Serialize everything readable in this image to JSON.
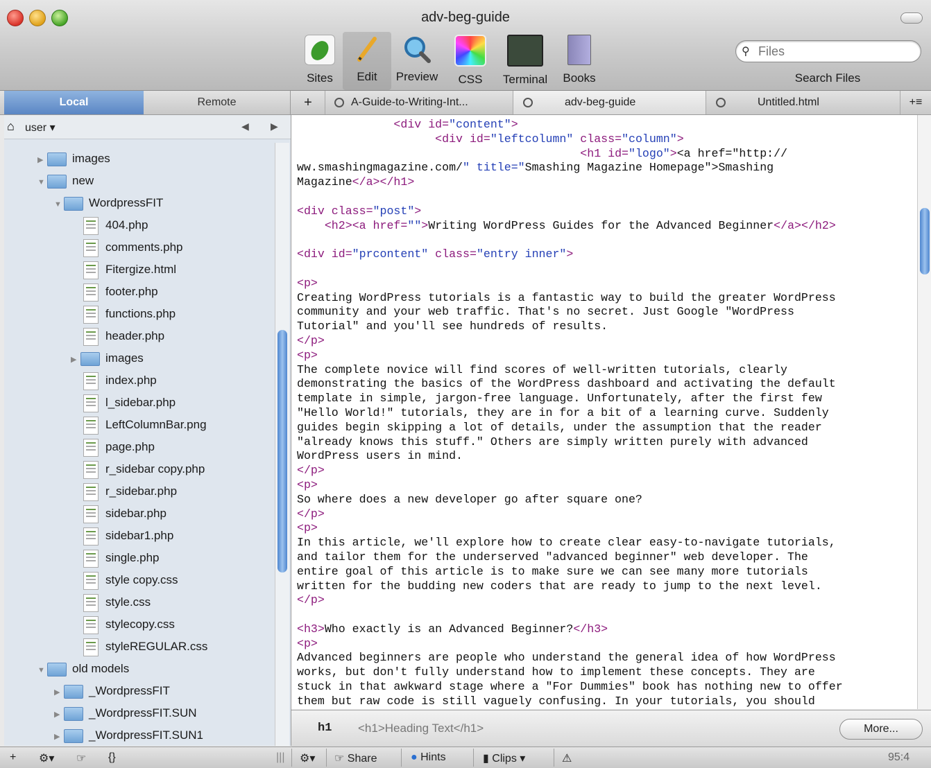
{
  "window": {
    "title": "adv-beg-guide"
  },
  "toolbar": {
    "items": [
      {
        "label": "Sites",
        "icon": "leaf-icon"
      },
      {
        "label": "Edit",
        "icon": "pencil-icon"
      },
      {
        "label": "Preview",
        "icon": "magnifier-icon"
      },
      {
        "label": "CSS",
        "icon": "color-wheel-icon"
      },
      {
        "label": "Terminal",
        "icon": "terminal-icon"
      },
      {
        "label": "Books",
        "icon": "book-icon"
      }
    ],
    "search_placeholder": "Files",
    "search_label": "Search Files"
  },
  "sidebar_tabs": {
    "local": "Local",
    "remote": "Remote"
  },
  "tabs": [
    {
      "label": "A-Guide-to-Writing-Int..."
    },
    {
      "label": "adv-beg-guide"
    },
    {
      "label": "Untitled.html"
    }
  ],
  "pathbar": {
    "user": "user"
  },
  "tree": [
    {
      "label": "images",
      "type": "folder",
      "level": 1,
      "open": false
    },
    {
      "label": "new",
      "type": "folder",
      "level": 1,
      "open": true
    },
    {
      "label": "WordpressFIT",
      "type": "folder",
      "level": 2,
      "open": true
    },
    {
      "label": "404.php",
      "type": "file",
      "level": 3
    },
    {
      "label": "comments.php",
      "type": "file",
      "level": 3
    },
    {
      "label": "Fitergize.html",
      "type": "file",
      "level": 3
    },
    {
      "label": "footer.php",
      "type": "file",
      "level": 3
    },
    {
      "label": "functions.php",
      "type": "file",
      "level": 3
    },
    {
      "label": "header.php",
      "type": "file",
      "level": 3
    },
    {
      "label": "images",
      "type": "folder",
      "level": 3,
      "open": false
    },
    {
      "label": "index.php",
      "type": "file",
      "level": 3
    },
    {
      "label": "l_sidebar.php",
      "type": "file",
      "level": 3
    },
    {
      "label": "LeftColumnBar.png",
      "type": "file",
      "level": 3
    },
    {
      "label": "page.php",
      "type": "file",
      "level": 3
    },
    {
      "label": "r_sidebar copy.php",
      "type": "file",
      "level": 3
    },
    {
      "label": "r_sidebar.php",
      "type": "file",
      "level": 3
    },
    {
      "label": "sidebar.php",
      "type": "file",
      "level": 3
    },
    {
      "label": "sidebar1.php",
      "type": "file",
      "level": 3
    },
    {
      "label": "single.php",
      "type": "file",
      "level": 3
    },
    {
      "label": "style copy.css",
      "type": "file",
      "level": 3
    },
    {
      "label": "style.css",
      "type": "file",
      "level": 3
    },
    {
      "label": "stylecopy.css",
      "type": "file",
      "level": 3
    },
    {
      "label": "styleREGULAR.css",
      "type": "file",
      "level": 3
    },
    {
      "label": "old models",
      "type": "folder",
      "level": 1,
      "open": true
    },
    {
      "label": "_WordpressFIT",
      "type": "folder",
      "level": 2,
      "open": false
    },
    {
      "label": "_WordpressFIT.SUN",
      "type": "folder",
      "level": 2,
      "open": false
    },
    {
      "label": "_WordpressFIT.SUN1",
      "type": "folder",
      "level": 2,
      "open": false
    }
  ],
  "code_lines": [
    "              <div id=\"content\">",
    "                    <div id=\"leftcolumn\" class=\"column\">",
    "                                         <h1 id=\"logo\"><a href=\"http://",
    "ww.smashingmagazine.com/\" title=\"Smashing Magazine Homepage\">Smashing",
    "Magazine</a></h1>",
    "",
    "<div class=\"post\">",
    "    <h2><a href=\"\">Writing WordPress Guides for the Advanced Beginner</a></h2>",
    "",
    "<div id=\"prcontent\" class=\"entry inner\">",
    "",
    "<p>",
    "Creating WordPress tutorials is a fantastic way to build the greater WordPress",
    "community and your web traffic. That's no secret. Just Google \"WordPress",
    "Tutorial\" and you'll see hundreds of results.",
    "</p>",
    "<p>",
    "The complete novice will find scores of well-written tutorials, clearly",
    "demonstrating the basics of the WordPress dashboard and activating the default",
    "template in simple, jargon-free language. Unfortunately, after the first few",
    "\"Hello World!\" tutorials, they are in for a bit of a learning curve. Suddenly",
    "guides begin skipping a lot of details, under the assumption that the reader",
    "\"already knows this stuff.\" Others are simply written purely with advanced",
    "WordPress users in mind.",
    "</p>",
    "<p>",
    "So where does a new developer go after square one?",
    "</p>",
    "<p>",
    "In this article, we'll explore how to create clear easy-to-navigate tutorials,",
    "and tailor them for the underserved \"advanced beginner\" web developer. The",
    "entire goal of this article is to make sure we can see many more tutorials",
    "written for the budding new coders that are ready to jump to the next level.",
    "</p>",
    "",
    "<h3>Who exactly is an Advanced Beginner?</h3>",
    "<p>",
    "Advanced beginners are people who understand the general idea of how WordPress",
    "works, but don't fully understand how to implement these concepts. They are",
    "stuck in that awkward stage where a \"For Dummies\" book has nothing new to offer",
    "them but raw code is still vaguely confusing. In your tutorials, you should"
  ],
  "tagbar": {
    "tag": "h1",
    "snippet": "<h1>Heading Text</h1>",
    "more": "More..."
  },
  "bottombar": {
    "share": "Share",
    "hints": "Hints",
    "clips": "Clips",
    "position": "95:4"
  }
}
